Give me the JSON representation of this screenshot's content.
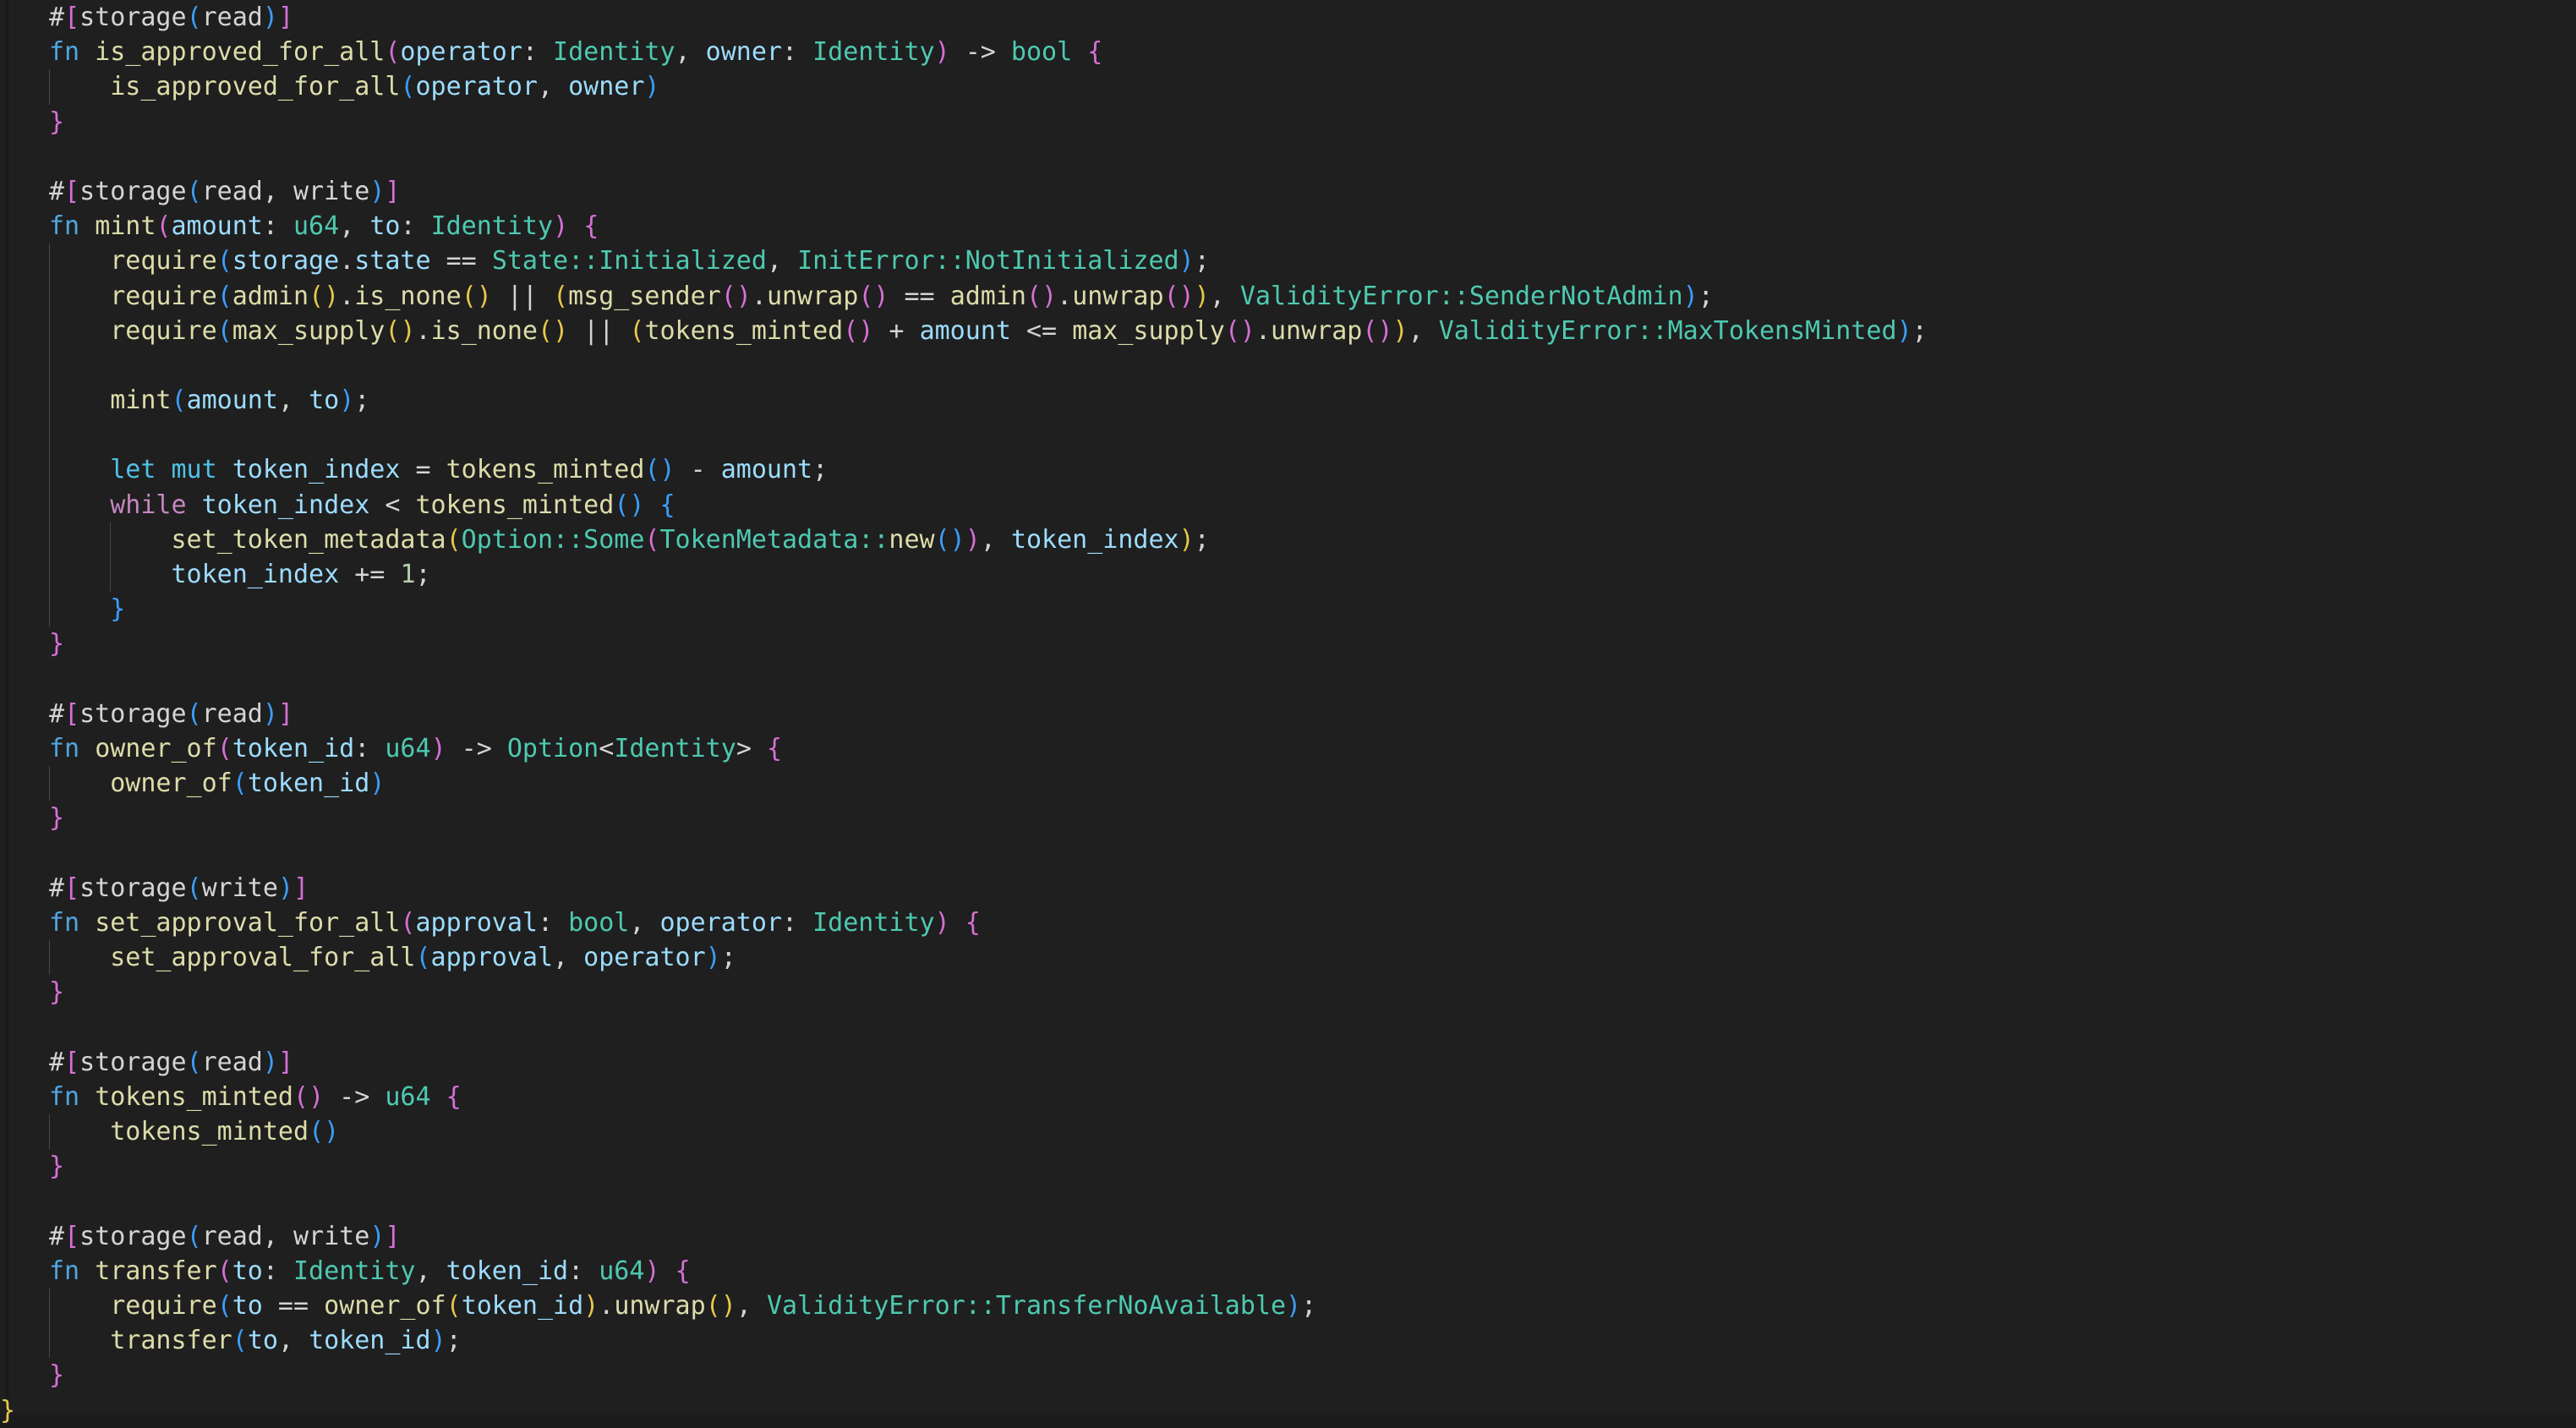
{
  "editor": {
    "language": "sway",
    "theme": "dark-plus",
    "background": "#1f1f1f",
    "font_size_px": 30,
    "line_height_px": 41.2,
    "colors": {
      "background": "#1f1f1f",
      "foreground": "#d4d4d4",
      "keyword": "#4fa6e0",
      "keyword_storage": "#4fc1e9",
      "control_flow": "#c586c0",
      "function_name": "#dcdcaa",
      "type": "#4ec9b0",
      "variable": "#9cdcfe",
      "number": "#b5cea8",
      "bracket_level_1": "#3b9eff",
      "bracket_level_2": "#e6c949",
      "bracket_level_3": "#d670d6",
      "indent_guide": "#474747"
    }
  },
  "code": {
    "lines": [
      "    #[storage(read)]",
      "    fn is_approved_for_all(operator: Identity, owner: Identity) -> bool {",
      "        is_approved_for_all(operator, owner)",
      "    }",
      "",
      "    #[storage(read, write)]",
      "    fn mint(amount: u64, to: Identity) {",
      "        require(storage.state == State::Initialized, InitError::NotInitialized);",
      "        require(admin().is_none() || (msg_sender().unwrap() == admin().unwrap()), ValidityError::SenderNotAdmin);",
      "        require(max_supply().is_none() || (tokens_minted() + amount <= max_supply().unwrap()), ValidityError::MaxTokensMinted);",
      "",
      "        mint(amount, to);",
      "",
      "        let mut token_index = tokens_minted() - amount;",
      "        while token_index < tokens_minted() {",
      "            set_token_metadata(Option::Some(TokenMetadata::new()), token_index);",
      "            token_index += 1;",
      "        }",
      "    }",
      "",
      "    #[storage(read)]",
      "    fn owner_of(token_id: u64) -> Option<Identity> {",
      "        owner_of(token_id)",
      "    }",
      "",
      "    #[storage(write)]",
      "    fn set_approval_for_all(approval: bool, operator: Identity) {",
      "        set_approval_for_all(approval, operator);",
      "    }",
      "",
      "    #[storage(read)]",
      "    fn tokens_minted() -> u64 {",
      "        tokens_minted()",
      "    }",
      "",
      "    #[storage(read, write)]",
      "    fn transfer(to: Identity, token_id: u64) {",
      "        require(to == owner_of(token_id).unwrap(), ValidityError::TransferNoAvailable);",
      "        transfer(to, token_id);",
      "    }",
      "}"
    ],
    "symbols": {
      "attributes": [
        "#[storage(read)]",
        "#[storage(read, write)]",
        "#[storage(write)]"
      ],
      "functions": [
        "is_approved_for_all",
        "mint",
        "owner_of",
        "set_approval_for_all",
        "tokens_minted",
        "transfer"
      ],
      "types": [
        "Identity",
        "u64",
        "bool",
        "Option",
        "State",
        "InitError",
        "ValidityError",
        "TokenMetadata"
      ],
      "error_variants": [
        "InitError::NotInitialized",
        "ValidityError::SenderNotAdmin",
        "ValidityError::MaxTokensMinted",
        "ValidityError::TransferNoAvailable"
      ],
      "enum_variants": [
        "State::Initialized",
        "Option::Some"
      ],
      "keywords": [
        "fn",
        "let",
        "mut",
        "while"
      ],
      "numbers": [
        "1",
        "64"
      ]
    }
  }
}
